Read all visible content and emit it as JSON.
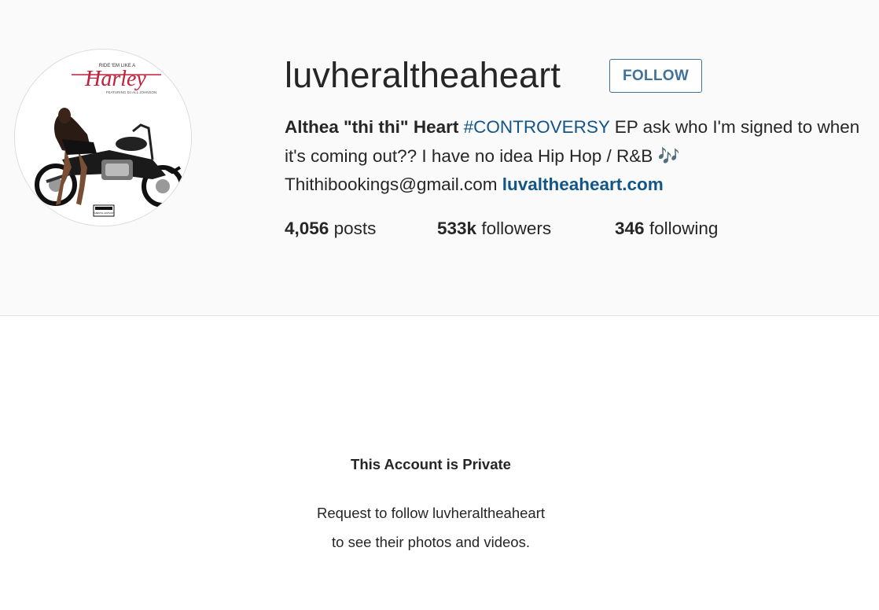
{
  "profile": {
    "username": "luvheraltheaheart",
    "follow_label": "FOLLOW",
    "avatar_text": {
      "top": "RIDE 'EM LIKE A",
      "title": "Harley",
      "sub": "FEATURING DJ ALL JOHNSON",
      "badge": "PARENTAL ADVISORY"
    }
  },
  "bio": {
    "full_name": "Althea \"thi thi\" Heart",
    "hashtag": "#CONTROVERSY",
    "text_line": " EP ask who I'm signed to when it's coming out?? I have no idea Hip Hop / R&B 🎶",
    "email": "Thithibookings@gmail.com",
    "website": "luvaltheaheart.com"
  },
  "stats": {
    "posts_count": "4,056",
    "posts_label": "posts",
    "followers_count": "533k",
    "followers_label": "followers",
    "following_count": "346",
    "following_label": "following"
  },
  "private_notice": {
    "title": "This Account is Private",
    "line1": "Request to follow luvheraltheaheart",
    "line2": "to see their photos and videos."
  },
  "colors": {
    "header_bg": "#fafafa",
    "accent_blue": "#3f729b",
    "link_blue": "#125688",
    "avatar_title_red": "#c2213b"
  }
}
